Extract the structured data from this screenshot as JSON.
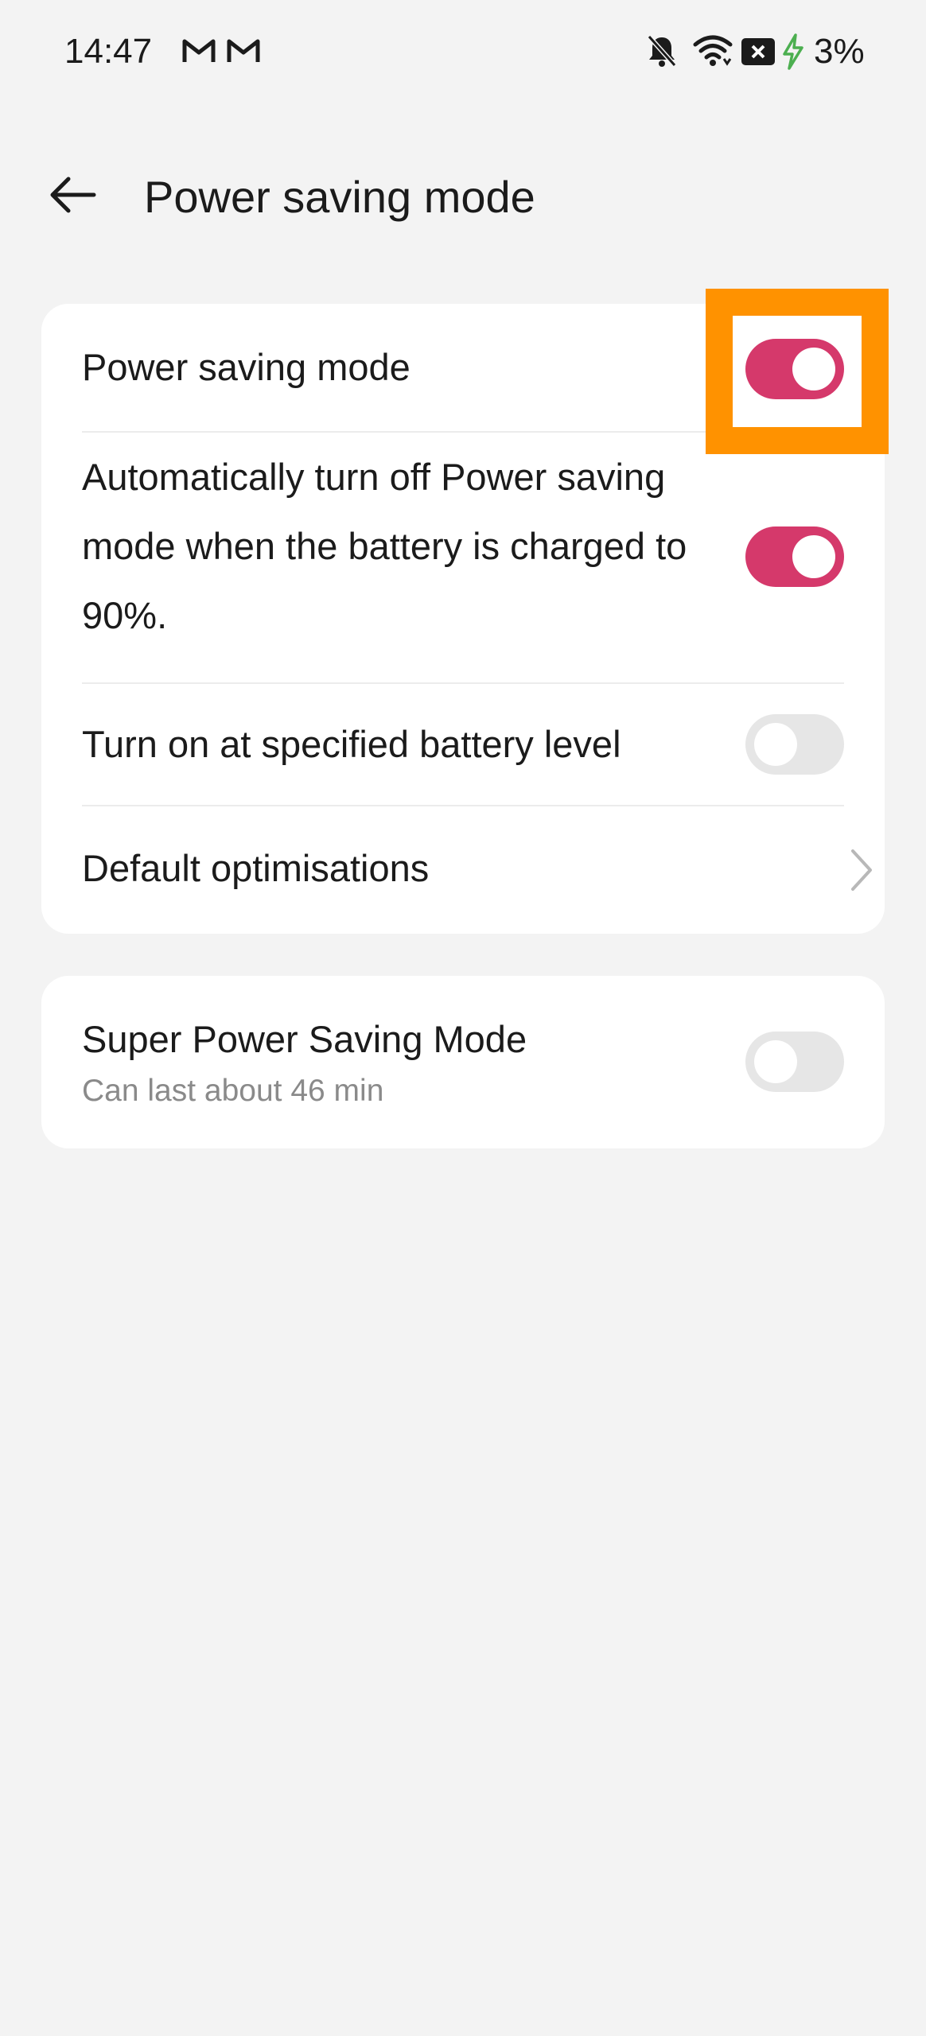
{
  "status_bar": {
    "time": "14:47",
    "left_icons": [
      "gmail-icon",
      "gmail-icon"
    ],
    "right_icons": [
      "notifications-off-icon",
      "wifi-icon",
      "sim-error-icon",
      "charging-bolt-icon"
    ],
    "battery": "3%",
    "charging_color": "#4caf50"
  },
  "app_bar": {
    "back_icon": "arrow-left-icon",
    "title": "Power saving mode"
  },
  "settings_card": {
    "items": [
      {
        "label": "Power saving mode",
        "control": "toggle",
        "on": true
      },
      {
        "label": "Automatically turn off Power saving mode when the battery is charged to 90%.",
        "control": "toggle",
        "on": true
      },
      {
        "label": "Turn on at specified battery level",
        "control": "toggle",
        "on": false
      },
      {
        "label": "Default optimisations",
        "control": "chevron-right-icon"
      }
    ]
  },
  "super_card": {
    "title": "Super Power Saving Mode",
    "subtitle": "Can last about 46 min",
    "control": "toggle",
    "on": false
  },
  "colors": {
    "accent": "#d5396b",
    "toggle_off": "#e6e6e6",
    "highlight": "#ff9200",
    "background": "#f3f3f3",
    "card": "#ffffff"
  }
}
